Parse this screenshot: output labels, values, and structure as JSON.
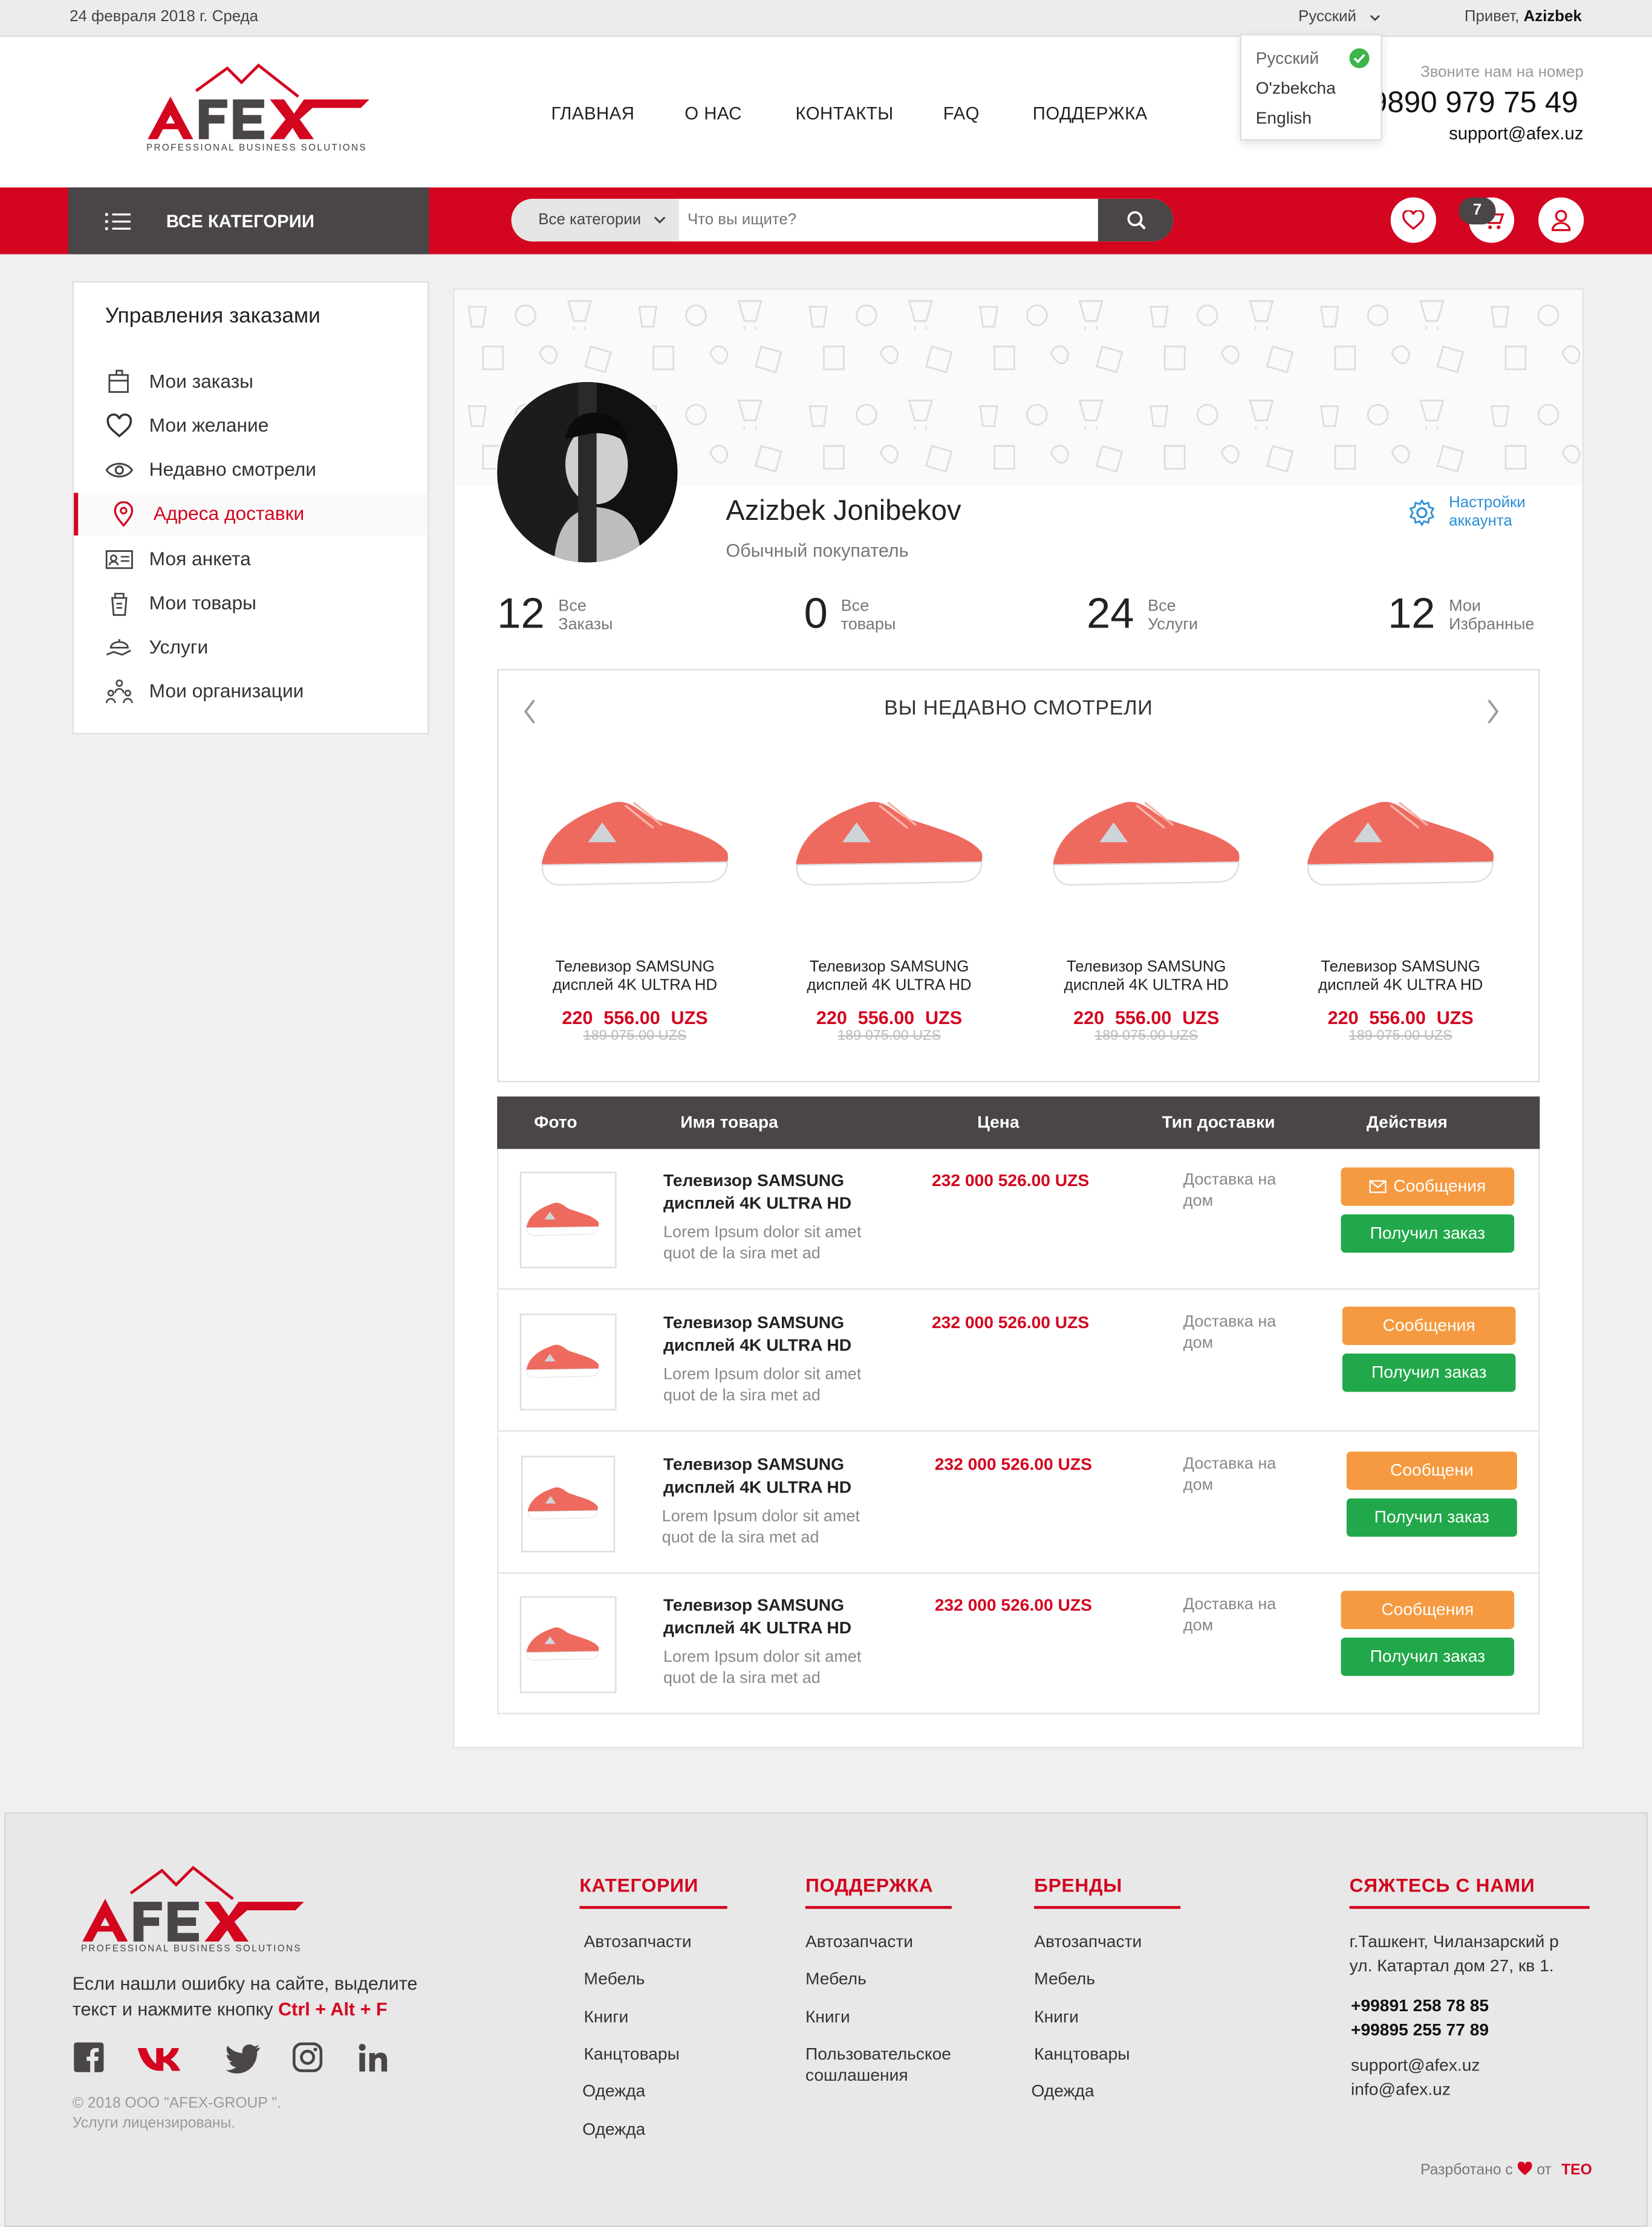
{
  "topbar": {
    "date": "24 февраля 2018 г.  Среда",
    "language": "Русский",
    "greeting": "Привет,",
    "user": "Azizbek"
  },
  "brand": {
    "logo_text": "AFEX",
    "tagline": "PROFESSIONAL BUSINESS SOLUTIONS",
    "accent": "#d3051f",
    "dark": "#4a4546"
  },
  "nav": [
    "ГЛАВНАЯ",
    "О НАС",
    "КОНТАКТЫ",
    "FAQ",
    "ПОДДЕРЖКА"
  ],
  "languages": [
    "Русский",
    "O'zbekcha",
    "English"
  ],
  "contact": {
    "call_label": "Звоните нам на номер",
    "phone": "9890 979 75 49",
    "email": "support@afex.uz"
  },
  "toolbar": {
    "all_categories": "ВСЕ КАТЕГОРИИ",
    "category_select": "Все категории",
    "search_placeholder": "Что вы ищите?",
    "cart_count": "7"
  },
  "sidebar": {
    "title": "Управления заказами",
    "items": [
      {
        "label": "Мои заказы",
        "icon": "orders-box-icon"
      },
      {
        "label": "Мои желание",
        "icon": "heart-icon"
      },
      {
        "label": "Недавно смотрели",
        "icon": "eye-icon"
      },
      {
        "label": "Адреса доставки",
        "icon": "map-pin-icon"
      },
      {
        "label": "Моя анкета",
        "icon": "id-card-icon"
      },
      {
        "label": "Мои товары",
        "icon": "goods-icon"
      },
      {
        "label": "Услуги",
        "icon": "hand-service-icon"
      },
      {
        "label": "Мои организации",
        "icon": "organization-icon"
      }
    ]
  },
  "profile": {
    "name": "Azizbek Jonibekov",
    "role": "Обычный покупатель",
    "settings": [
      "Настройки",
      "аккаунта"
    ]
  },
  "stats": [
    {
      "value": "12",
      "line1": "Все",
      "line2": "Заказы"
    },
    {
      "value": "0",
      "line1": "Все",
      "line2": "товары"
    },
    {
      "value": "24",
      "line1": "Все",
      "line2": "Услуги"
    },
    {
      "value": "12",
      "line1": "Мои",
      "line2": "Избранные"
    }
  ],
  "recent": {
    "title": "ВЫ НЕДАВНО СМОТРЕЛИ",
    "products": [
      {
        "name1": "Телевизор SAMSUNG",
        "name2": "дисплей 4K ULTRA HD",
        "price": "220 556.00  UZS",
        "old": "189 075.00 UZS"
      },
      {
        "name1": "Телевизор SAMSUNG",
        "name2": "дисплей 4K ULTRA HD",
        "price": "220 556.00  UZS",
        "old": "189 075.00 UZS"
      },
      {
        "name1": "Телевизор SAMSUNG",
        "name2": "дисплей 4K ULTRA HD",
        "price": "220 556.00  UZS",
        "old": "189 075.00 UZS"
      },
      {
        "name1": "Телевизор SAMSUNG",
        "name2": "дисплей 4K ULTRA HD",
        "price": "220 556.00  UZS",
        "old": "189 075.00 UZS"
      }
    ]
  },
  "orders": {
    "columns": [
      "Фото",
      "Имя товара",
      "Цена",
      "Тип доставки",
      "Действия"
    ],
    "rows": [
      {
        "name": "Телевизор SAMSUNG дисплей 4K ULTRA HD",
        "desc": "Lorem Ipsum dolor sit amet quot de la sira met ad",
        "price": "232 000 526.00 UZS",
        "delivery": "Доставка на дом",
        "msg": "Сообщения",
        "receive": "Получил заказ"
      },
      {
        "name": "Телевизор SAMSUNG дисплей 4K ULTRA HD",
        "desc": "Lorem Ipsum dolor sit amet quot de la sira met ad",
        "price": "232 000 526.00 UZS",
        "delivery": "Доставка на дом",
        "msg": "Сообщения",
        "receive": "Получил заказ"
      },
      {
        "name": "Телевизор SAMSUNG дисплей 4K ULTRA HD",
        "desc": "Lorem Ipsum dolor sit amet quot de la sira met ad",
        "price": "232 000 526.00 UZS",
        "delivery": "Доставка на дом",
        "msg": "Сообщени",
        "receive": "Получил заказ"
      },
      {
        "name": "Телевизор SAMSUNG дисплей 4K ULTRA HD",
        "desc": "Lorem Ipsum dolor sit amet quot de la sira met ad",
        "price": "232 000 526.00 UZS",
        "delivery": "Доставка на дом",
        "msg": "Сообщения",
        "receive": "Получил заказ"
      }
    ]
  },
  "footer": {
    "error_text": "Если нашли ошибку на сайте, выделите текст и нажмите кнопку",
    "hotkey": "Ctrl + Alt + F",
    "copyright1": "© 2018 ООО \"AFEX-GROUP \".",
    "copyright2": "Услуги лицензированы.",
    "columns": [
      {
        "title": "КАТЕГОРИИ",
        "links": [
          "Автозапчасти",
          "Мебель",
          "Книги",
          "Канцтовары",
          "Одежда",
          "Одежда"
        ]
      },
      {
        "title": "ПОДДЕРЖКА",
        "links": [
          "Автозапчасти",
          "Мебель",
          "Книги",
          "Пользовательское сошлашения"
        ]
      },
      {
        "title": "БРЕНДЫ",
        "links": [
          "Автозапчасти",
          "Мебель",
          "Книги",
          "Канцтовары",
          "Одежда"
        ]
      }
    ],
    "contact_title": "СЯЖТЕСЬ С НАМИ",
    "address": [
      "г.Ташкент, Чиланзарский р",
      "ул. Катартал дом 27, кв 1."
    ],
    "phones": [
      "+99891 258 78 85",
      "+99895 255 77 89"
    ],
    "emails": [
      "support@afex.uz",
      "info@afex.uz"
    ],
    "credits_prefix": "Разрботано с",
    "credits_from": "от",
    "credits_by": "TEO"
  }
}
